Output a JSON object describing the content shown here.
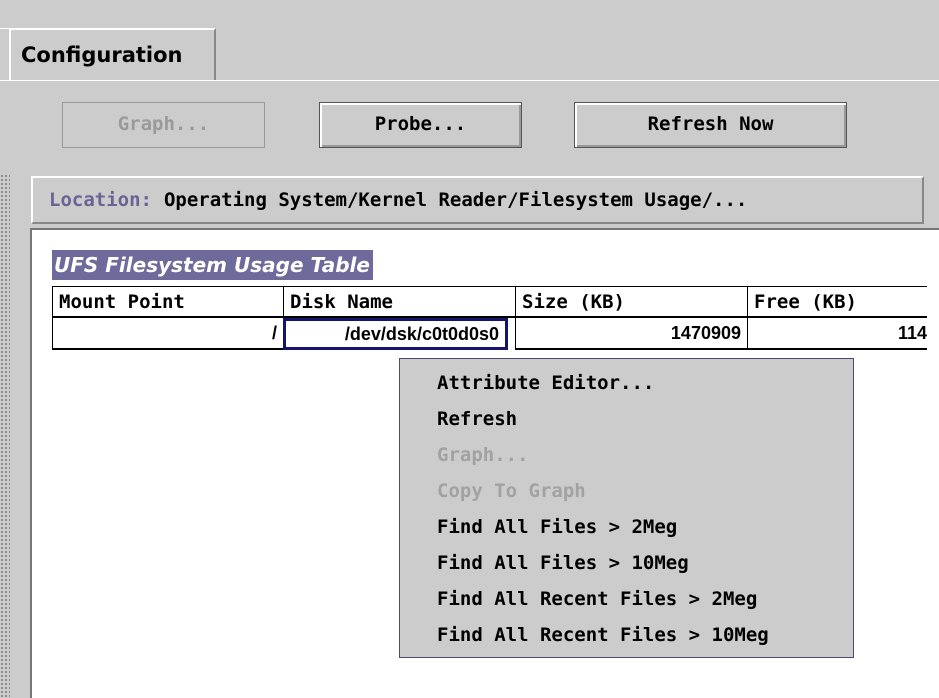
{
  "tabs": [
    {
      "label": "Configuration"
    }
  ],
  "toolbar": {
    "graph_label": "Graph...",
    "probe_label": "Probe...",
    "refresh_label": "Refresh Now"
  },
  "location": {
    "label": "Location:",
    "value": "Operating System/Kernel Reader/Filesystem Usage/..."
  },
  "table": {
    "title": "UFS Filesystem Usage Table",
    "headers": [
      "Mount Point",
      "Disk Name",
      "Size (KB)",
      "Free (KB)"
    ],
    "rows": [
      {
        "mount_point": "/",
        "disk_name": "/dev/dsk/c0t0d0s0",
        "size_kb": "1470909",
        "free_kb": "114"
      }
    ]
  },
  "context_menu": {
    "items": [
      {
        "label": "Attribute Editor...",
        "enabled": true
      },
      {
        "label": "Refresh",
        "enabled": true
      },
      {
        "label": "Graph...",
        "enabled": false
      },
      {
        "label": "Copy To Graph",
        "enabled": false
      },
      {
        "label": "Find All Files > 2Meg",
        "enabled": true
      },
      {
        "label": "Find All Files > 10Meg",
        "enabled": true
      },
      {
        "label": "Find All Recent Files > 2Meg",
        "enabled": true
      },
      {
        "label": "Find All Recent Files > 10Meg",
        "enabled": true
      }
    ]
  },
  "colors": {
    "panel": "#cccccc",
    "accent": "#6e6a9c",
    "selection_border": "#14146e",
    "disabled_text": "#9a9a9a"
  }
}
